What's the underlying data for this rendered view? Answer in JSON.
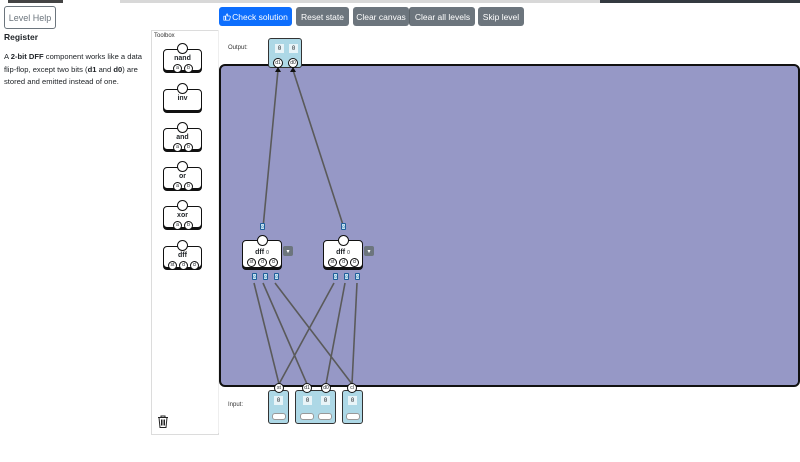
{
  "header": {
    "level_help": "Level Help",
    "buttons": {
      "check": "Check solution",
      "reset": "Reset state",
      "clear_canvas": "Clear canvas",
      "clear_all": "Clear all levels",
      "skip": "Skip level"
    }
  },
  "description": {
    "title": "Register",
    "t1": "A ",
    "b1": "2-bit DFF",
    "t2": " component works like a data flip-flop, except two bits (",
    "b2": "d1",
    "t3": " and ",
    "b3": "d0",
    "t4": ") are stored and emitted instead of one."
  },
  "toolbox": {
    "label": "Toolbox",
    "items": [
      {
        "name": "nand",
        "pins": [
          "a",
          "b"
        ]
      },
      {
        "name": "inv",
        "pins": []
      },
      {
        "name": "and",
        "pins": [
          "a",
          "b"
        ]
      },
      {
        "name": "or",
        "pins": [
          "a",
          "b"
        ]
      },
      {
        "name": "xor",
        "pins": [
          "a",
          "b"
        ]
      },
      {
        "name": "dff",
        "pins": [
          "st",
          "d",
          "cl"
        ]
      }
    ]
  },
  "canvas": {
    "output_label": "Output:",
    "input_label": "Input:",
    "outputs": [
      {
        "pin": "d1",
        "value": "0"
      },
      {
        "pin": "d0",
        "value": "0"
      }
    ],
    "inputs": [
      {
        "pin": "st",
        "value": "0"
      },
      {
        "pin": "d1",
        "value": "0"
      },
      {
        "pin": "d0",
        "value": "0"
      },
      {
        "pin": "cl",
        "value": "0"
      }
    ],
    "components": [
      {
        "name": "dff",
        "suffix": "0",
        "pins": [
          "st",
          "d",
          "cl"
        ],
        "out_probe": "0",
        "in_probes": [
          "0",
          "0",
          "0"
        ]
      },
      {
        "name": "dff",
        "suffix": "0",
        "pins": [
          "st",
          "d",
          "cl"
        ],
        "out_probe": "0",
        "in_probes": [
          "0",
          "0",
          "0"
        ]
      }
    ],
    "menu_glyph": "▾"
  },
  "colors": {
    "board": "#9698c6",
    "io": "#add8e6",
    "primary": "#0d6efd",
    "secondary": "#6c757d"
  }
}
